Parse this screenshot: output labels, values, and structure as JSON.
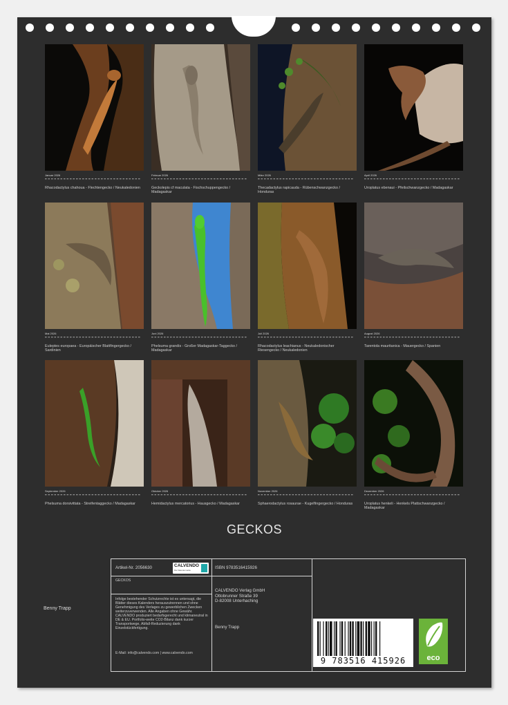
{
  "title": "GECKOS",
  "author": "Benny Trapp",
  "months": [
    {
      "name": "Januar 2026",
      "caption": "Rhacodactylus chahoua - Flechtengecko / Neukaledonien"
    },
    {
      "name": "Februar 2026",
      "caption": "Geckolepis cf maculata - Fischschuppengecko / Madagaskar"
    },
    {
      "name": "März 2026",
      "caption": "Thecadactylus rapicauda - Rübenschwanzgecko / Honduras"
    },
    {
      "name": "April 2026",
      "caption": "Uroplatus ebenaui - Pfeilschwanzgecko / Madagaskar"
    },
    {
      "name": "Mai 2026",
      "caption": "Euleptes europaea - Europäischer Blattfingergecko / Sardinien"
    },
    {
      "name": "Juni 2026",
      "caption": "Phelsuma grandis - Großer Madagaskar-Taggecko / Madagaskar"
    },
    {
      "name": "Juli 2026",
      "caption": "Rhacodactylus leachianus - Neukaledonischer Riesengecko / Neukaledonien"
    },
    {
      "name": "August 2026",
      "caption": "Tarentola mauritanica - Mauergecko / Spanien"
    },
    {
      "name": "September 2026",
      "caption": "Phelsuma dorsivittata - Streifentaggecko / Madagaskar"
    },
    {
      "name": "Oktober 2026",
      "caption": "Hemidactylus mercatorius - Hausgecko / Madagaskar"
    },
    {
      "name": "November 2026",
      "caption": "Sphaerodactylus rosaurae - Kugelfingergecko / Honduras"
    },
    {
      "name": "Dezember 2026",
      "caption": "Uroplatus henkeli - Henkels Plattschwanzgecko / Madagaskar"
    }
  ],
  "info": {
    "article": "Artikel-Nr. 2056630",
    "logo_text": "CALVENDO",
    "logo_sub": "Die Kalendermarke",
    "product_title": "GECKOS",
    "notice": "Infolge bestehender Schutzrechte ist es untersagt, die Blätter dieses Kalenders herauszutrennen und ohne Genehmigung des Verlages zu gewerblichen Zwecken weiterzuverwenden. Alle Angaben ohne Gewähr. CALVENDO produziert bedarfsgerecht und klimaneutral in DE & EU. Portfolio-weite CO2-Bilanz dank kurzer Transportwege, Abfall-Reduzierung dank Einzelstückfertigung.",
    "email": "E-Mail: info@calvendo.com",
    "web": "www.calvendo.com",
    "isbn": "ISBN 9783516415926",
    "publisher": [
      "CALVENDO Verlag GmbH",
      "Ottobrunner Straße 39",
      "D-82008 Unterhaching"
    ],
    "author": "Benny Trapp",
    "barcode_digits": "9 783516 415926",
    "eco_label": "eco"
  },
  "colors": {
    "sheet": "#2d2d2d",
    "eco": "#6bb33a",
    "logo_accent": "#1fa7a8"
  }
}
